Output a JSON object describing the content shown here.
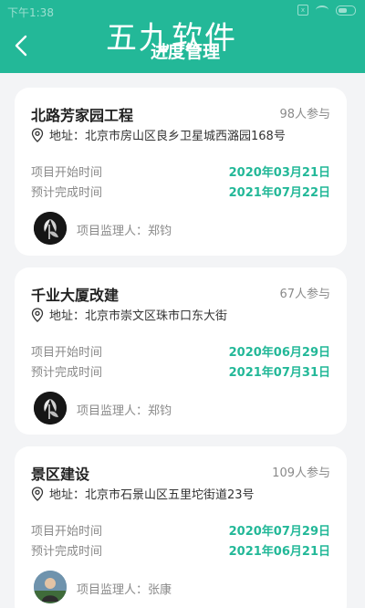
{
  "status_bar": {
    "time": "下午1:38",
    "sim_label": "x"
  },
  "header": {
    "back_label": "<",
    "watermark": "五九软件",
    "title": "进度管理"
  },
  "labels": {
    "address_prefix": "地址：",
    "start_label": "项目开始时间",
    "end_label": "预计完成时间",
    "supervisor_prefix": "项目监理人："
  },
  "projects": [
    {
      "name": "北路芳家园工程",
      "participants": "98人参与",
      "address": "地址：北京市房山区良乡卫星城西潞园168号",
      "start_date": "2020年03月21日",
      "end_date": "2021年07月22日",
      "supervisor": "项目监理人：郑钧",
      "avatar": "dark-plant-avatar"
    },
    {
      "name": "千业大厦改建",
      "participants": "67人参与",
      "address": "地址：北京市崇文区珠市口东大街",
      "start_date": "2020年06月29日",
      "end_date": "2021年07月31日",
      "supervisor": "项目监理人：郑钧",
      "avatar": "dark-plant-avatar"
    },
    {
      "name": "景区建设",
      "participants": "109人参与",
      "address": "地址：北京市石景山区五里坨街道23号",
      "start_date": "2020年07月29日",
      "end_date": "2021年06月21日",
      "supervisor": "项目监理人：张康",
      "avatar": "person-photo-avatar"
    }
  ],
  "colors": {
    "accent": "#23b898",
    "background": "#f3f4f6",
    "card": "#ffffff"
  }
}
